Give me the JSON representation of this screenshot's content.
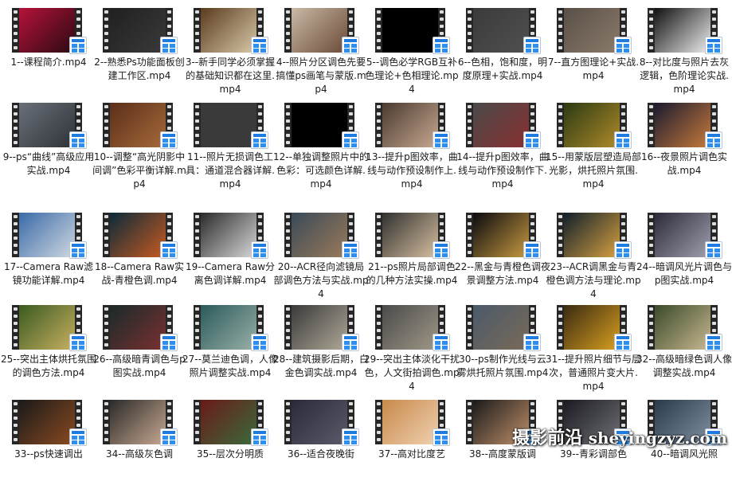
{
  "files": [
    {
      "name": "1--课程简介.mp4",
      "thumb": [
        "#b5123a",
        "#2a0a12"
      ]
    },
    {
      "name": "2--熟悉Ps功能面板创建工作区.mp4",
      "thumb": [
        "#202020",
        "#3a3a3a"
      ]
    },
    {
      "name": "3--新手同学必须掌握的基础知识都在这里.mp4",
      "thumb": [
        "#5a3b1e",
        "#d8c8a8"
      ]
    },
    {
      "name": "4--照片分区调色先要搞懂ps画笔与蒙版.mp4",
      "thumb": [
        "#c9b9a5",
        "#6a4a38"
      ]
    },
    {
      "name": "5--调色必学RGB互补色理论+色相理论.mp4",
      "thumb": [
        "#000000",
        "#000000"
      ]
    },
    {
      "name": "6--色相，饱和度，明度原理+实战.mp4",
      "thumb": [
        "#3a3a3a",
        "#505050"
      ]
    },
    {
      "name": "7--直方图理论+实战.mp4",
      "thumb": [
        "#5a5048",
        "#8a7a6a"
      ]
    },
    {
      "name": "8--对比度与照片去灰逻辑，色阶理论实战.mp4",
      "thumb": [
        "#111111",
        "#eeeeee"
      ]
    },
    {
      "name": "9--ps“曲线”高级应用实战.mp4",
      "thumb": [
        "#6a7078",
        "#2e3238"
      ]
    },
    {
      "name": "10--调整“高光阴影中间调”色彩平衡详解.mp4",
      "thumb": [
        "#5a2e1a",
        "#a66a3a"
      ]
    },
    {
      "name": "11--照片无损调色工具：通道混合器详解.mp4",
      "thumb": [
        "#3a3a3a",
        "#3a3a3a"
      ]
    },
    {
      "name": "12--单独调整照片中的色彩：可选颜色详解.mp4",
      "thumb": [
        "#000000",
        "#000000"
      ]
    },
    {
      "name": "13--提升p图效率，曲线与动作预设制作上.mp4",
      "thumb": [
        "#4a3a30",
        "#c8a890"
      ]
    },
    {
      "name": "14--提升p图效率，曲线与动作预设制作下.mp4",
      "thumb": [
        "#4a4a4a",
        "#8a3030"
      ]
    },
    {
      "name": "15--用蒙版层塑造局部光影，烘托照片氛围.mp4",
      "thumb": [
        "#2a3a12",
        "#b08a2a"
      ]
    },
    {
      "name": "16--夜景照片调色实战.mp4",
      "thumb": [
        "#1a1a30",
        "#c87a3a"
      ]
    },
    {
      "name": "17--Camera Raw滤镜功能详解.mp4",
      "thumb": [
        "#3a6aa8",
        "#d0d8e0"
      ]
    },
    {
      "name": "18--Camera Raw实战-青橙色调.mp4",
      "thumb": [
        "#0a2a3a",
        "#c85a20"
      ]
    },
    {
      "name": "19--Camera Raw分离色调详解.mp4",
      "thumb": [
        "#2a2a2a",
        "#d8d8d8"
      ]
    },
    {
      "name": "20--ACR径向滤镜局部调色方法与实战.mp4",
      "thumb": [
        "#3a4a58",
        "#9a7a5a"
      ]
    },
    {
      "name": "21--ps照片局部调色的几种方法实操.mp4",
      "thumb": [
        "#303030",
        "#d8c0a0"
      ]
    },
    {
      "name": "22--黑金与青橙色调夜景调整方法.mp4",
      "thumb": [
        "#0a0a10",
        "#c89a40"
      ]
    },
    {
      "name": "23--ACR调黑金与青橙色调方法与理论.mp4",
      "thumb": [
        "#10202a",
        "#d8a040"
      ]
    },
    {
      "name": "24--暗调风光片调色与p图实战.mp4",
      "thumb": [
        "#2a2a38",
        "#a0a0b0"
      ]
    },
    {
      "name": "25--突出主体烘托氛围的调色方法.mp4",
      "thumb": [
        "#3a5a20",
        "#c8b060"
      ]
    },
    {
      "name": "26--高级暗青调色与p图实战.mp4",
      "thumb": [
        "#1a2a2a",
        "#7a3030"
      ]
    },
    {
      "name": "27--莫兰迪色调，人像照片调整实战.mp4",
      "thumb": [
        "#2a5a5a",
        "#9ab0a8"
      ]
    },
    {
      "name": "28--建筑摄影后期，白金色调实战.mp4",
      "thumb": [
        "#3a3a3a",
        "#b0a898"
      ]
    },
    {
      "name": "29--突出主体淡化干扰色，人文街拍调色.mp4",
      "thumb": [
        "#4a4a4a",
        "#a09888"
      ]
    },
    {
      "name": "30--ps制作光线与云雾烘托照片氛围.mp4",
      "thumb": [
        "#4a5a6a",
        "#7a6a58"
      ]
    },
    {
      "name": "31--提升照片细节与层次，普通照片变大片.mp4",
      "thumb": [
        "#3a2a12",
        "#d8a020"
      ]
    },
    {
      "name": "32--高级暗绿色调人像调整实战.mp4",
      "thumb": [
        "#3a4a2a",
        "#c8b890"
      ]
    },
    {
      "name": "33--ps快速调出",
      "thumb": [
        "#1a1a1a",
        "#8a4a20"
      ]
    },
    {
      "name": "34--高级灰色调",
      "thumb": [
        "#2a2a2a",
        "#c8a890"
      ]
    },
    {
      "name": "35--层次分明质",
      "thumb": [
        "#6a1a1a",
        "#3a6a3a"
      ]
    },
    {
      "name": "36--适合夜晚街",
      "thumb": [
        "#2a2a3a",
        "#5a5a6a"
      ]
    },
    {
      "name": "37--高对比度艺",
      "thumb": [
        "#c88a4a",
        "#f0d0b0"
      ]
    },
    {
      "name": "38--高度蒙版调",
      "thumb": [
        "#1a1a1a",
        "#c0906a"
      ]
    },
    {
      "name": "39--青彩调部色",
      "thumb": [
        "#1a1a20",
        "#707078"
      ]
    },
    {
      "name": "40--暗调风光照",
      "thumb": [
        "#2a3a4a",
        "#8090a0"
      ]
    }
  ],
  "watermark": {
    "brand": "摄影前沿",
    "url": "sheyingzyz.com"
  },
  "icons": {
    "badge": "video-file-icon"
  }
}
